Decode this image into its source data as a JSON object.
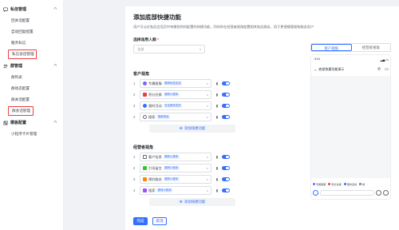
{
  "sidebar": {
    "groups": [
      {
        "label": "私信管理",
        "items": [
          "回关话配置",
          "自动回复配置",
          "服务私信",
          "私信会话管理"
        ]
      },
      {
        "label": "群管理",
        "items": [
          "群列表",
          "群动态配置",
          "群关话配置",
          "群会话管理"
        ]
      },
      {
        "label": "模板配置",
        "items": [
          "小程序卡片管理"
        ]
      }
    ]
  },
  "page": {
    "title": "添加底部快捷功能",
    "description": "用户可以在私信会话页中快捷找到所配置的快捷功能，同时你在经营者视角配置相关私信服务，用于更便捷管理和服务用户"
  },
  "form": {
    "applicable_label": "选择适用人群",
    "applicable_required": "*",
    "applicable_value": "全部",
    "customer_section": "客户视角",
    "customer_rows": [
      {
        "num": "1",
        "name": "专属客服",
        "tag": "跳转私信会话"
      },
      {
        "num": "2",
        "name": "积分兑换",
        "tag": "跳转小程序"
      },
      {
        "num": "3",
        "name": "限时活动",
        "tag": "在全屏浏览页"
      },
      {
        "num": "4",
        "name": "搜索",
        "tag": "搜索商品"
      }
    ],
    "add_button": "添加快捷功能",
    "operator_section": "经营者视角",
    "operator_rows": [
      {
        "num": "1",
        "name": "客户信息",
        "tag": "跳转小程序"
      },
      {
        "num": "2",
        "name": "引导留言",
        "tag": "跳转小程序"
      },
      {
        "num": "3",
        "name": "预约服务",
        "tag": "跳转小程序"
      },
      {
        "num": "4",
        "name": "搜索",
        "tag": "跳转小程序"
      }
    ],
    "add_button_2": "添加快捷功能",
    "done": "完成",
    "cancel": "取消"
  },
  "preview": {
    "tab_customer": "客户视角",
    "tab_operator": "经营者视角",
    "status_time": "9:41",
    "chat_title": "底部快捷功能演示",
    "shortcuts": [
      "专属客服",
      "积分兑换",
      "限时活动",
      "搜"
    ]
  },
  "colors": {
    "accent": "#3370ff",
    "highlight_box": "#e8403f"
  }
}
